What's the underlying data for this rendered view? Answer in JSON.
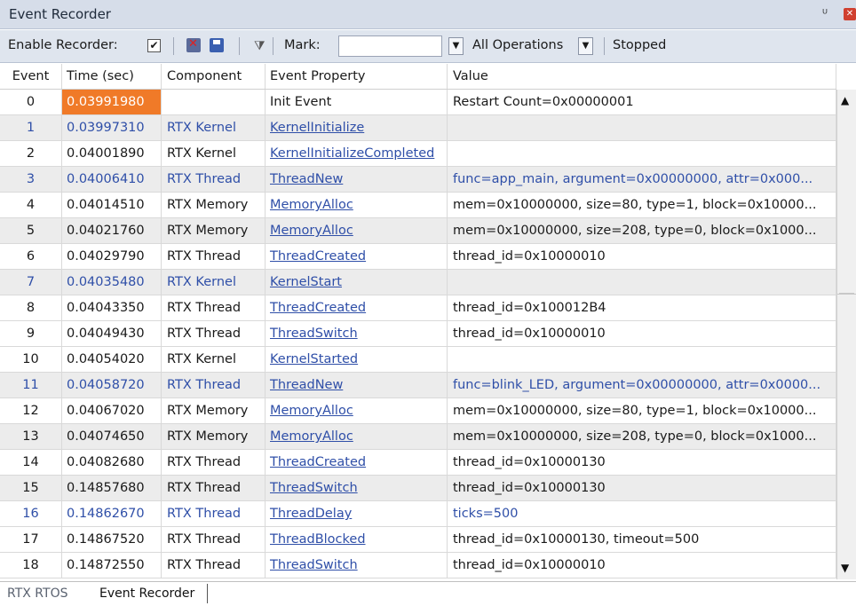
{
  "window": {
    "title": "Event Recorder"
  },
  "toolbar": {
    "enable_label": "Enable Recorder:",
    "enable_checked": "✔",
    "mark_label": "Mark:",
    "mark_value": "",
    "operations_value": "All Operations",
    "status": "Stopped"
  },
  "columns": [
    "Event",
    "Time (sec)",
    "Component",
    "Event Property",
    "Value"
  ],
  "rows": [
    {
      "event": "0",
      "time": "0.03991980",
      "component": "",
      "property": "Init Event",
      "value": "Restart Count=0x00000001"
    },
    {
      "event": "1",
      "time": "0.03997310",
      "component": "RTX Kernel",
      "property": "KernelInitialize",
      "value": ""
    },
    {
      "event": "2",
      "time": "0.04001890",
      "component": "RTX Kernel",
      "property": "KernelInitializeCompleted",
      "value": ""
    },
    {
      "event": "3",
      "time": "0.04006410",
      "component": "RTX Thread",
      "property": "ThreadNew",
      "value": "func=app_main, argument=0x00000000, attr=0x000..."
    },
    {
      "event": "4",
      "time": "0.04014510",
      "component": "RTX Memory",
      "property": "MemoryAlloc",
      "value": "mem=0x10000000, size=80, type=1, block=0x10000..."
    },
    {
      "event": "5",
      "time": "0.04021760",
      "component": "RTX Memory",
      "property": "MemoryAlloc",
      "value": "mem=0x10000000, size=208, type=0, block=0x1000..."
    },
    {
      "event": "6",
      "time": "0.04029790",
      "component": "RTX Thread",
      "property": "ThreadCreated",
      "value": "thread_id=0x10000010"
    },
    {
      "event": "7",
      "time": "0.04035480",
      "component": "RTX Kernel",
      "property": "KernelStart",
      "value": ""
    },
    {
      "event": "8",
      "time": "0.04043350",
      "component": "RTX Thread",
      "property": "ThreadCreated",
      "value": "thread_id=0x100012B4"
    },
    {
      "event": "9",
      "time": "0.04049430",
      "component": "RTX Thread",
      "property": "ThreadSwitch",
      "value": "thread_id=0x10000010"
    },
    {
      "event": "10",
      "time": "0.04054020",
      "component": "RTX Kernel",
      "property": "KernelStarted",
      "value": ""
    },
    {
      "event": "11",
      "time": "0.04058720",
      "component": "RTX Thread",
      "property": "ThreadNew",
      "value": "func=blink_LED, argument=0x00000000, attr=0x0000..."
    },
    {
      "event": "12",
      "time": "0.04067020",
      "component": "RTX Memory",
      "property": "MemoryAlloc",
      "value": "mem=0x10000000, size=80, type=1, block=0x10000..."
    },
    {
      "event": "13",
      "time": "0.04074650",
      "component": "RTX Memory",
      "property": "MemoryAlloc",
      "value": "mem=0x10000000, size=208, type=0, block=0x1000..."
    },
    {
      "event": "14",
      "time": "0.04082680",
      "component": "RTX Thread",
      "property": "ThreadCreated",
      "value": "thread_id=0x10000130"
    },
    {
      "event": "15",
      "time": "0.14857680",
      "component": "RTX Thread",
      "property": "ThreadSwitch",
      "value": "thread_id=0x10000130"
    },
    {
      "event": "16",
      "time": "0.14862670",
      "component": "RTX Thread",
      "property": "ThreadDelay",
      "value": "ticks=500"
    },
    {
      "event": "17",
      "time": "0.14867520",
      "component": "RTX Thread",
      "property": "ThreadBlocked",
      "value": "thread_id=0x10000130, timeout=500"
    },
    {
      "event": "18",
      "time": "0.14872550",
      "component": "RTX Thread",
      "property": "ThreadSwitch",
      "value": "thread_id=0x10000010"
    }
  ],
  "row_styles": {
    "blue_events": [
      "1",
      "3",
      "7",
      "11",
      "16"
    ],
    "alt_events": [
      "1",
      "3",
      "5",
      "7",
      "11",
      "13",
      "15"
    ],
    "highlight_color": "#f07a28",
    "link_color": "#2f4fa8"
  },
  "tabs": [
    {
      "label": "RTX RTOS",
      "active": false
    },
    {
      "label": "Event Recorder",
      "active": true
    }
  ]
}
